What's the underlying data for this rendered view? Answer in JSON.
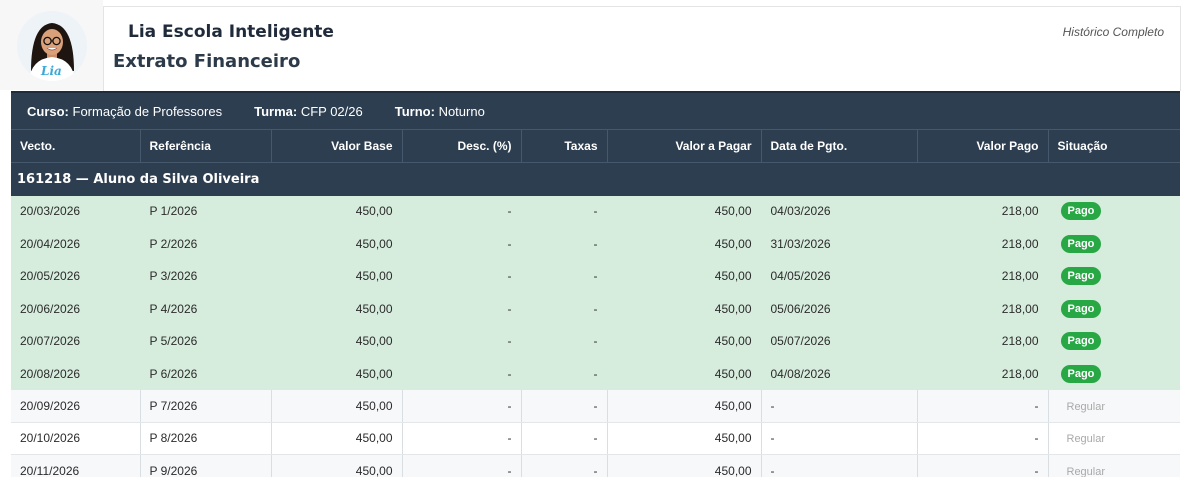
{
  "header": {
    "school_name": "Lia Escola Inteligente",
    "document_title": "Extrato Financeiro",
    "history_link": "Histórico Completo",
    "avatar_label": "Lia"
  },
  "info": {
    "curso_label": "Curso:",
    "curso_value": "Formação de Professores",
    "turma_label": "Turma:",
    "turma_value": "CFP 02/26",
    "turno_label": "Turno:",
    "turno_value": "Noturno"
  },
  "table": {
    "columns": [
      "Vecto.",
      "Referência",
      "Valor Base",
      "Desc. (%)",
      "Taxas",
      "Valor a Pagar",
      "Data de Pgto.",
      "Valor Pago",
      "Situação"
    ],
    "group_label": "161218 — Aluno da Silva Oliveira",
    "rows": [
      [
        "20/03/2026",
        "P 1/2026",
        "450,00",
        "-",
        "-",
        "450,00",
        "04/03/2026",
        "218,00",
        "Pago"
      ],
      [
        "20/04/2026",
        "P 2/2026",
        "450,00",
        "-",
        "-",
        "450,00",
        "31/03/2026",
        "218,00",
        "Pago"
      ],
      [
        "20/05/2026",
        "P 3/2026",
        "450,00",
        "-",
        "-",
        "450,00",
        "04/05/2026",
        "218,00",
        "Pago"
      ],
      [
        "20/06/2026",
        "P 4/2026",
        "450,00",
        "-",
        "-",
        "450,00",
        "05/06/2026",
        "218,00",
        "Pago"
      ],
      [
        "20/07/2026",
        "P 5/2026",
        "450,00",
        "-",
        "-",
        "450,00",
        "05/07/2026",
        "218,00",
        "Pago"
      ],
      [
        "20/08/2026",
        "P 6/2026",
        "450,00",
        "-",
        "-",
        "450,00",
        "04/08/2026",
        "218,00",
        "Pago"
      ],
      [
        "20/09/2026",
        "P 7/2026",
        "450,00",
        "-",
        "-",
        "450,00",
        "-",
        "-",
        "Regular"
      ],
      [
        "20/10/2026",
        "P 8/2026",
        "450,00",
        "-",
        "-",
        "450,00",
        "-",
        "-",
        "Regular"
      ],
      [
        "20/11/2026",
        "P 9/2026",
        "450,00",
        "-",
        "-",
        "450,00",
        "-",
        "-",
        "Regular"
      ]
    ]
  },
  "colors": {
    "header_bg": "#2d3e50",
    "paid_row_bg": "#d6ecdc",
    "paid_badge": "#28a745",
    "open_status_text": "#a9a9a9"
  }
}
